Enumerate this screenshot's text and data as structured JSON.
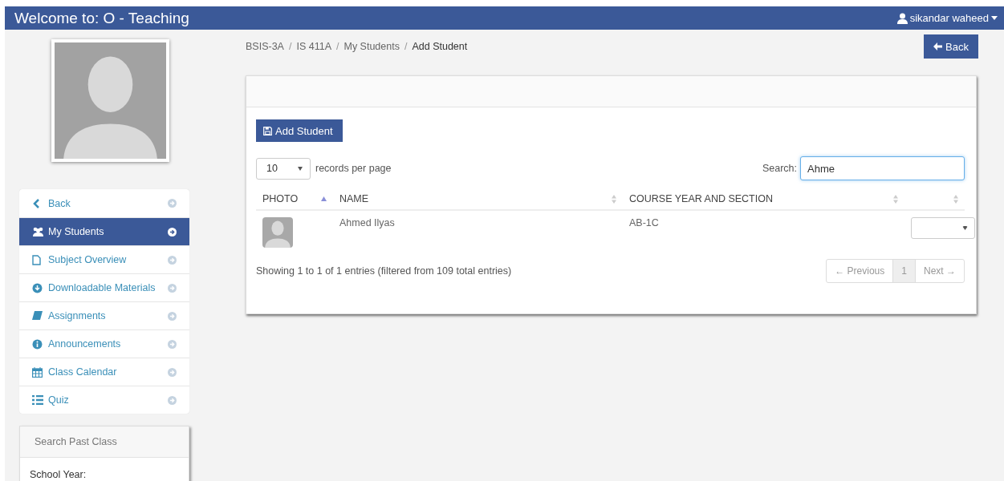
{
  "header": {
    "title": "Welcome to: O - Teaching",
    "user": "sikandar waheed"
  },
  "sidebar": {
    "items": [
      {
        "label": "Back",
        "selected": false
      },
      {
        "label": "My Students",
        "selected": true
      },
      {
        "label": "Subject Overview",
        "selected": false
      },
      {
        "label": "Downloadable Materials",
        "selected": false
      },
      {
        "label": "Assignments",
        "selected": false
      },
      {
        "label": "Announcements",
        "selected": false
      },
      {
        "label": "Class Calendar",
        "selected": false
      },
      {
        "label": "Quiz",
        "selected": false
      }
    ],
    "search_panel": {
      "title": "Search Past Class",
      "field_label": "School Year:"
    }
  },
  "breadcrumb": [
    {
      "label": "BSIS-3A",
      "current": false
    },
    {
      "separator": "/",
      "label": "IS 411A",
      "current": false
    },
    {
      "separator": "/",
      "label": "My Students",
      "current": false
    },
    {
      "separator": "/",
      "label": "Add Student",
      "current": true
    }
  ],
  "back_button": "Back",
  "add_button": "Add Student",
  "page_length": {
    "value": "10",
    "label": "records per page"
  },
  "search": {
    "label": "Search:",
    "value": "Ahme"
  },
  "table": {
    "columns": [
      {
        "label": "PHOTO",
        "sorted": true
      },
      {
        "label": "NAME",
        "sorted": false
      },
      {
        "label": "COURSE YEAR AND SECTION",
        "sorted": false
      },
      {
        "sorted": false
      }
    ],
    "rows": [
      {
        "name": "Ahmed Ilyas",
        "course": "AB-1C"
      }
    ]
  },
  "info": "Showing 1 to 1 of 1 entries (filtered from 109 total entries)",
  "pagination": {
    "previous": "← Previous",
    "pages": [
      {
        "label": "1",
        "selected": true
      }
    ],
    "next": "Next →"
  }
}
